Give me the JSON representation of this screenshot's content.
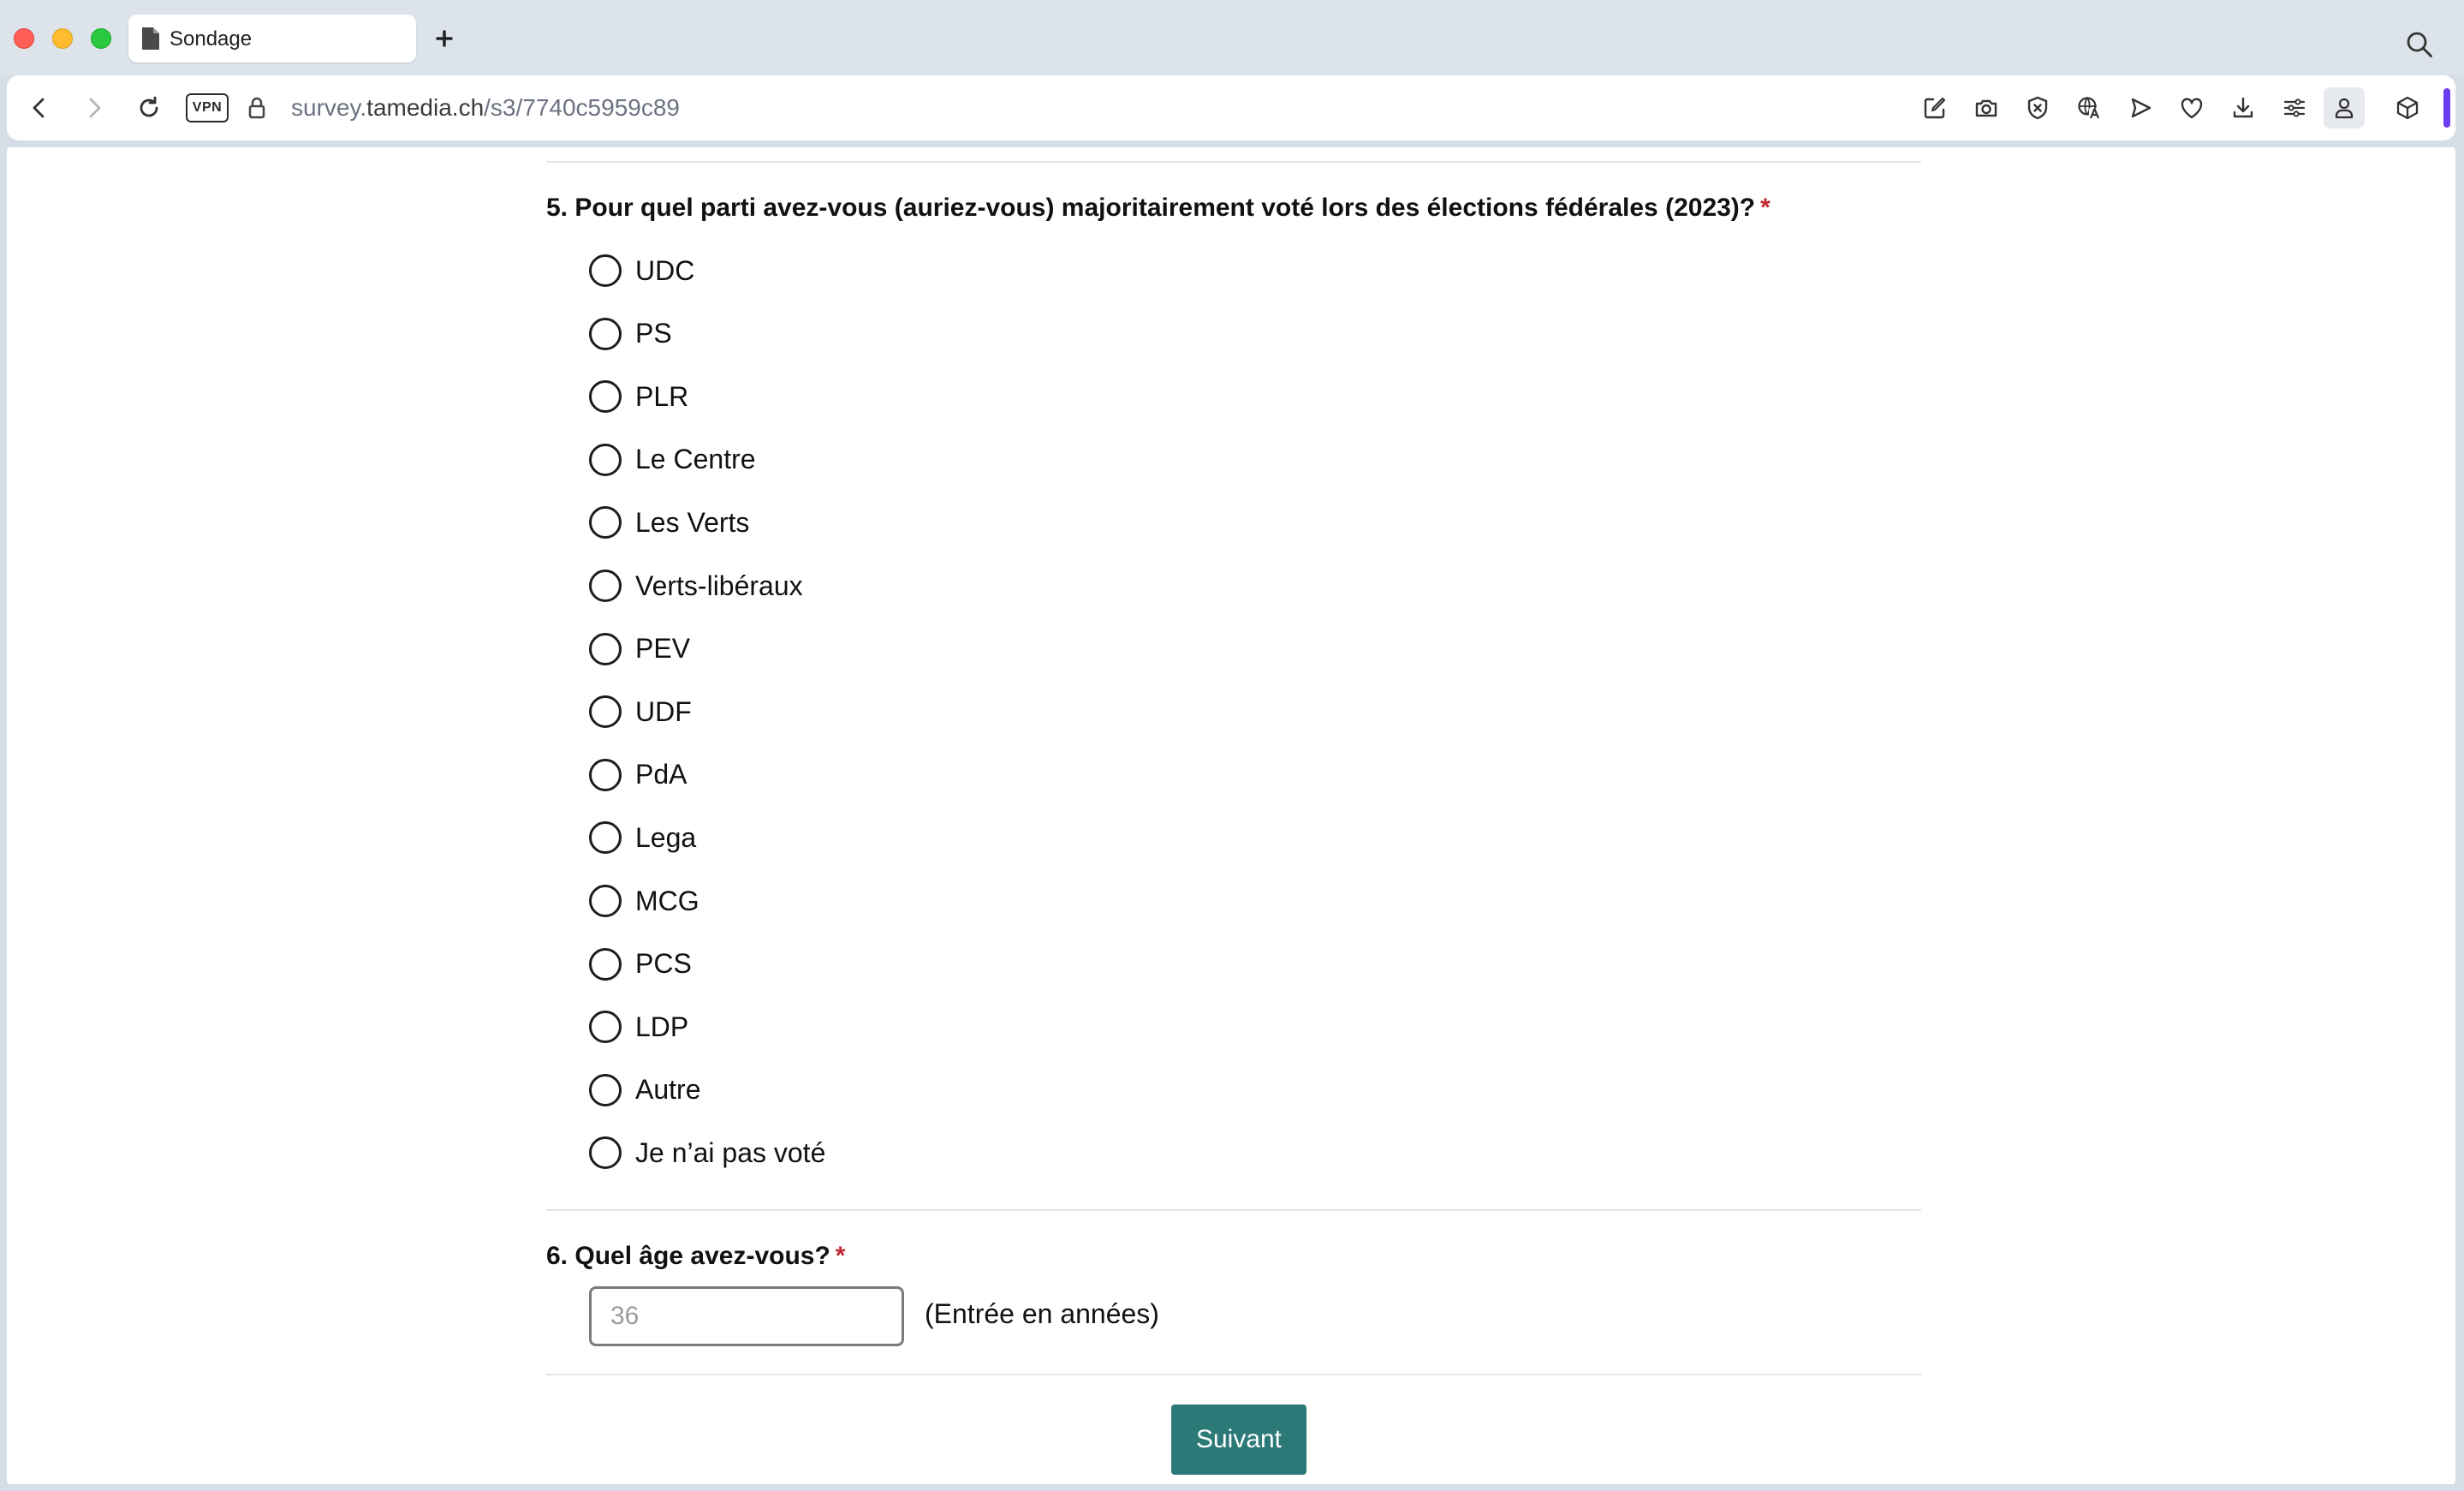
{
  "browser": {
    "tab_title": "Sondage",
    "url_prefix": "survey.",
    "url_domain": "tamedia.ch",
    "url_path": "/s3/7740c5959c89",
    "vpn_label": "VPN"
  },
  "survey": {
    "q5": {
      "text": "5. Pour quel parti avez-vous (auriez-vous) majoritairement voté lors des élections fédérales (2023)?",
      "required_mark": "*",
      "options": [
        "UDC",
        "PS",
        "PLR",
        "Le Centre",
        "Les Verts",
        "Verts-libéraux",
        "PEV",
        "UDF",
        "PdA",
        "Lega",
        "MCG",
        "PCS",
        "LDP",
        "Autre",
        "Je n’ai pas voté"
      ]
    },
    "q6": {
      "text": "6. Quel âge avez-vous?",
      "required_mark": "*",
      "placeholder": "36",
      "hint": "(Entrée en années)"
    },
    "next_label": "Suivant"
  },
  "colors": {
    "accent_button": "#2c7a78",
    "required": "#c0282d",
    "profile_accent": "#6a3cf0"
  }
}
